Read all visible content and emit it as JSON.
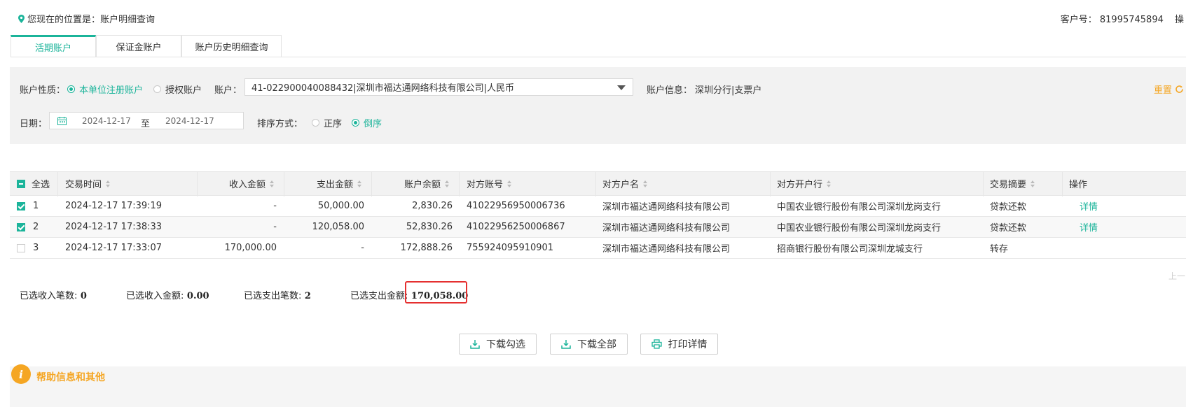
{
  "breadcrumb": {
    "prefix": "您现在的位置是：",
    "current": "账户明细查询"
  },
  "customer": {
    "label": "客户号：",
    "number": "81995745894",
    "more": "操"
  },
  "tabs": [
    {
      "label": "活期账户",
      "active": true
    },
    {
      "label": "保证金账户",
      "active": false
    },
    {
      "label": "账户历史明细查询",
      "active": false
    }
  ],
  "filter": {
    "account_type_label": "账户性质：",
    "account_type_options": [
      {
        "label": "本单位注册账户",
        "selected": true
      },
      {
        "label": "授权账户",
        "selected": false
      }
    ],
    "account_label": "账户：",
    "account_value": "41-022900040088432|深圳市福达通网络科技有限公司|人民币",
    "account_info_label": "账户信息：",
    "account_info_value": "深圳分行|支票户",
    "reset_label": "重置",
    "date_label": "日期：",
    "date_from": "2024-12-17",
    "date_sep": "至",
    "date_to": "2024-12-17",
    "sort_label": "排序方式：",
    "sort_options": [
      {
        "label": "正序",
        "selected": false
      },
      {
        "label": "倒序",
        "selected": true
      }
    ]
  },
  "table": {
    "headers": {
      "select_all": "全选",
      "time": "交易时间",
      "income": "收入金额",
      "expense": "支出金额",
      "balance": "账户余额",
      "counter_account": "对方账号",
      "counter_name": "对方户名",
      "counter_bank": "对方开户行",
      "summary": "交易摘要",
      "action": "操作"
    },
    "rows": [
      {
        "checked": true,
        "index": "1",
        "time": "2024-12-17 17:39:19",
        "income": "-",
        "expense": "50,000.00",
        "balance": "2,830.26",
        "counter_account": "41022956950006736",
        "counter_name": "深圳市福达通网络科技有限公司",
        "counter_bank": "中国农业银行股份有限公司深圳龙岗支行",
        "summary": "贷款还款",
        "action": "详情"
      },
      {
        "checked": true,
        "index": "2",
        "time": "2024-12-17 17:38:33",
        "income": "-",
        "expense": "120,058.00",
        "balance": "52,830.26",
        "counter_account": "41022956250006867",
        "counter_name": "深圳市福达通网络科技有限公司",
        "counter_bank": "中国农业银行股份有限公司深圳龙岗支行",
        "summary": "贷款还款",
        "action": "详情"
      },
      {
        "checked": false,
        "index": "3",
        "time": "2024-12-17 17:33:07",
        "income": "170,000.00",
        "expense": "-",
        "balance": "172,888.26",
        "counter_account": "755924095910901",
        "counter_name": "深圳市福达通网络科技有限公司",
        "counter_bank": "招商银行股份有限公司深圳龙城支行",
        "summary": "转存",
        "action": ""
      }
    ],
    "pager_text": "上一"
  },
  "summary": {
    "income_count_label": "已选收入笔数:",
    "income_count": "0",
    "income_amount_label": "已选收入金额:",
    "income_amount": "0.00",
    "expense_count_label": "已选支出笔数:",
    "expense_count": "2",
    "expense_amount_label": "已选支出金额:",
    "expense_amount": "170,058.00"
  },
  "buttons": {
    "download_selected": "下载勾选",
    "download_all": "下载全部",
    "print_detail": "打印详情"
  },
  "help": {
    "icon_glyph": "i",
    "title": "帮助信息和其他"
  },
  "colors": {
    "accent": "#1bb49a",
    "warning": "#f5a623",
    "highlight_border": "#e53030"
  }
}
